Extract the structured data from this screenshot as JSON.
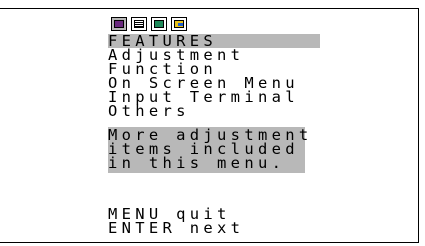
{
  "osd": {
    "icons": [
      {
        "name": "adjustment-icon",
        "color": "#6a2a7e",
        "selected": true
      },
      {
        "name": "function-icon",
        "color": "#000000",
        "selected": false
      },
      {
        "name": "on-screen-menu-icon",
        "color": "#1f8a5a",
        "selected": false
      },
      {
        "name": "input-terminal-icon",
        "color": "#e8c21a",
        "selected": false
      }
    ],
    "title": "FEATURES",
    "menu_items": [
      "Adjustment",
      "Function",
      "On Screen Menu",
      "Input Terminal",
      "Others"
    ],
    "description": [
      "More adjustment",
      "items included",
      "in this menu."
    ],
    "help": [
      "MENU quit",
      "ENTER next"
    ]
  },
  "colors": {
    "highlight": "#b8b8b8",
    "text": "#000000",
    "background": "#ffffff"
  }
}
